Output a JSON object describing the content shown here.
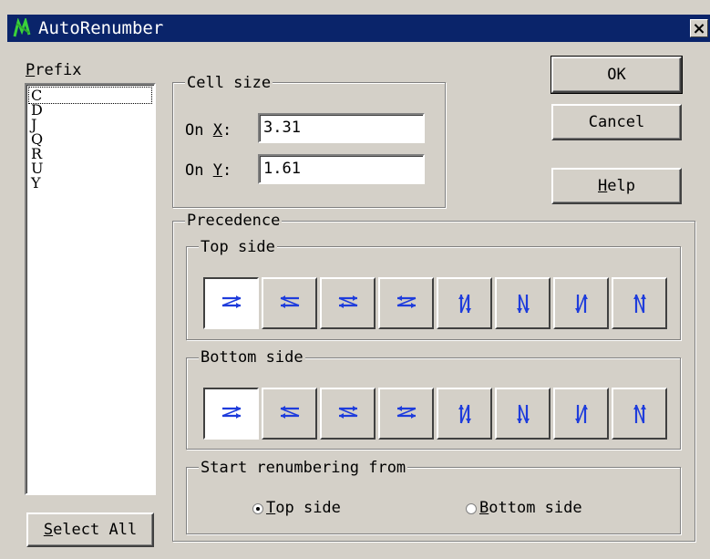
{
  "window": {
    "title": "AutoRenumber",
    "close_glyph": "×"
  },
  "prefix": {
    "label_key": "P",
    "label_rest": "refix",
    "items": [
      "C",
      "D",
      "J",
      "Q",
      "R",
      "U",
      "Y"
    ],
    "select_all_key": "S",
    "select_all_rest": "elect All"
  },
  "cell_size": {
    "title": "Cell size",
    "x_pre": "On ",
    "x_key": "X",
    "x_post": ":",
    "x_value": "3.31",
    "y_pre": "On ",
    "y_key": "Y",
    "y_post": ":",
    "y_value": "1.61"
  },
  "buttons": {
    "ok": "OK",
    "cancel": "Cancel",
    "help_key": "H",
    "help_rest": "elp"
  },
  "precedence": {
    "title": "Precedence",
    "top_side_title": "Top side",
    "bottom_side_title": "Bottom side",
    "order_icons": [
      "horizontal-zigzag-icon",
      "horizontal-zigzag-reversed-icon",
      "horizontal-zigzag-alt-icon",
      "horizontal-zigzag-alt-reversed-icon",
      "vertical-zigzag-icon",
      "vertical-zigzag-alt-icon",
      "vertical-zigzag-reversed-icon",
      "vertical-zigzag-alt-reversed-icon"
    ],
    "top_selected_index": 0,
    "bottom_selected_index": 0
  },
  "start_from": {
    "title": "Start renumbering from",
    "top_key": "T",
    "top_rest": "op side",
    "bottom_key": "B",
    "bottom_rest": "ottom side",
    "selected": "top"
  },
  "colors": {
    "titlebar": "#0a246a",
    "face": "#d4d0c8",
    "icon_blue": "#1e3cdc"
  }
}
